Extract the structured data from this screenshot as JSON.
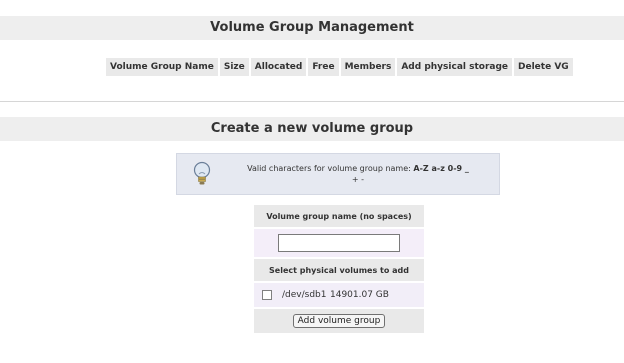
{
  "management": {
    "title": "Volume Group Management",
    "columns": [
      "Volume Group Name",
      "Size",
      "Allocated",
      "Free",
      "Members",
      "Add physical storage",
      "Delete VG"
    ]
  },
  "create": {
    "title": "Create a new volume group",
    "tip_prefix": "Valid characters for volume group name: ",
    "tip_chars_bold": "A-Z a-z 0-9 _",
    "tip_chars_rest": "+ -",
    "name_label": "Volume group name (no spaces)",
    "name_value": "",
    "pv_label": "Select physical volumes to add",
    "pvs": [
      {
        "device": "/dev/sdb1",
        "size": "14901.07 GB",
        "checked": false
      }
    ],
    "submit_label": "Add volume group"
  },
  "icons": {
    "tip": "lightbulb-icon"
  }
}
